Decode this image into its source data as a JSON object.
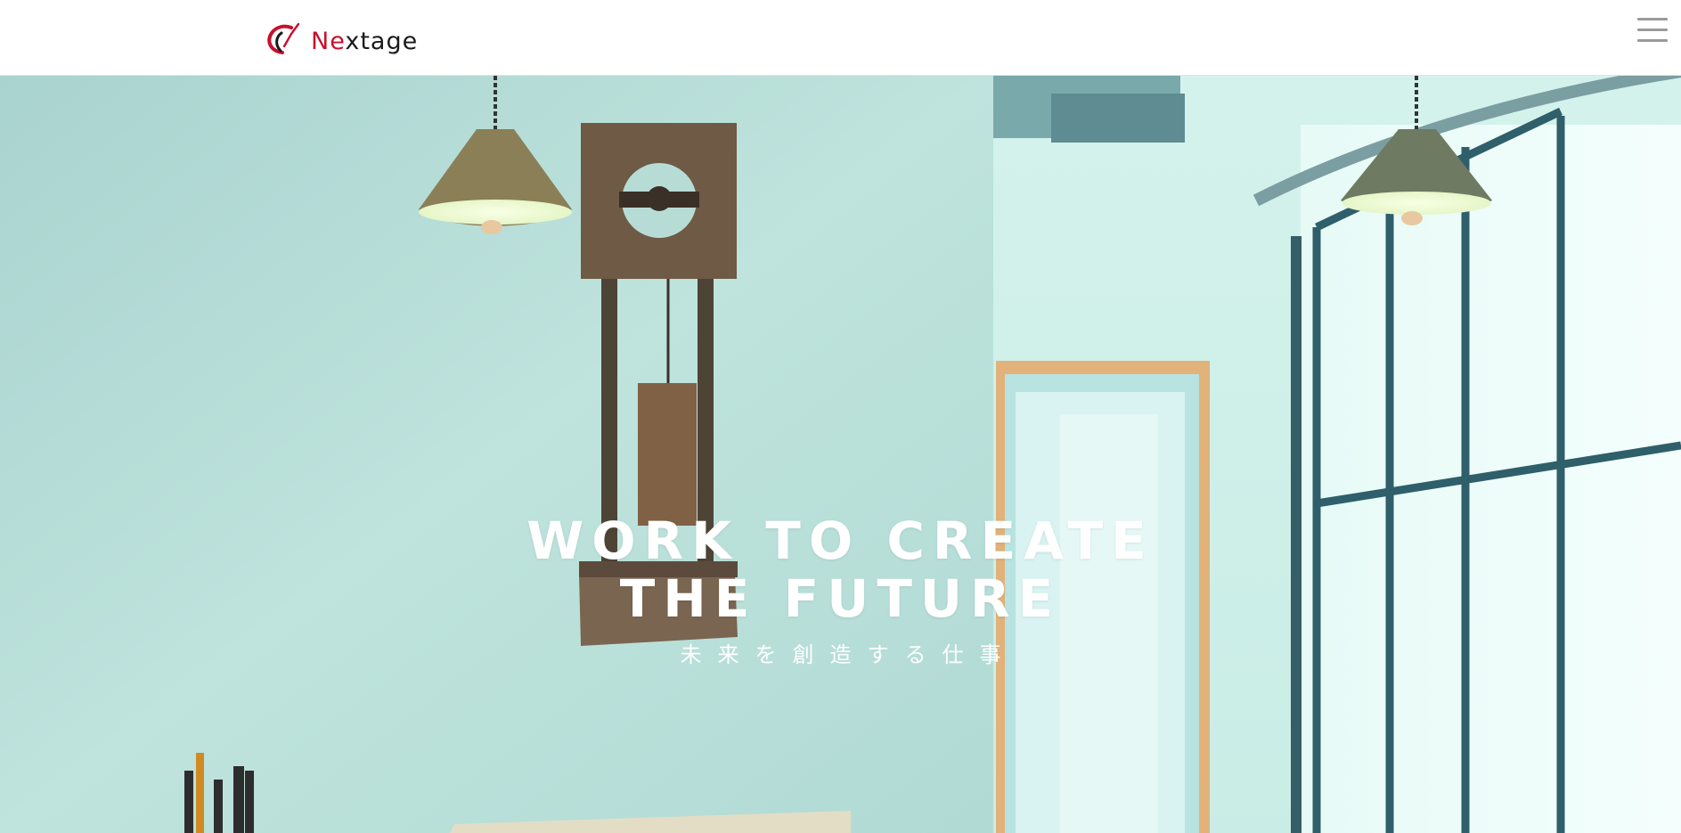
{
  "header": {
    "logo": {
      "part1": "Ne",
      "part2": "x",
      "part3": "tage",
      "brand_red": "#c8102e"
    },
    "menu_icon": "hamburger-menu-icon"
  },
  "hero": {
    "headline_line1": "WORK TO CREATE",
    "headline_line2": "THE FUTURE",
    "subline": "未来を創造する仕事",
    "tint_color": "#c7ece5"
  }
}
